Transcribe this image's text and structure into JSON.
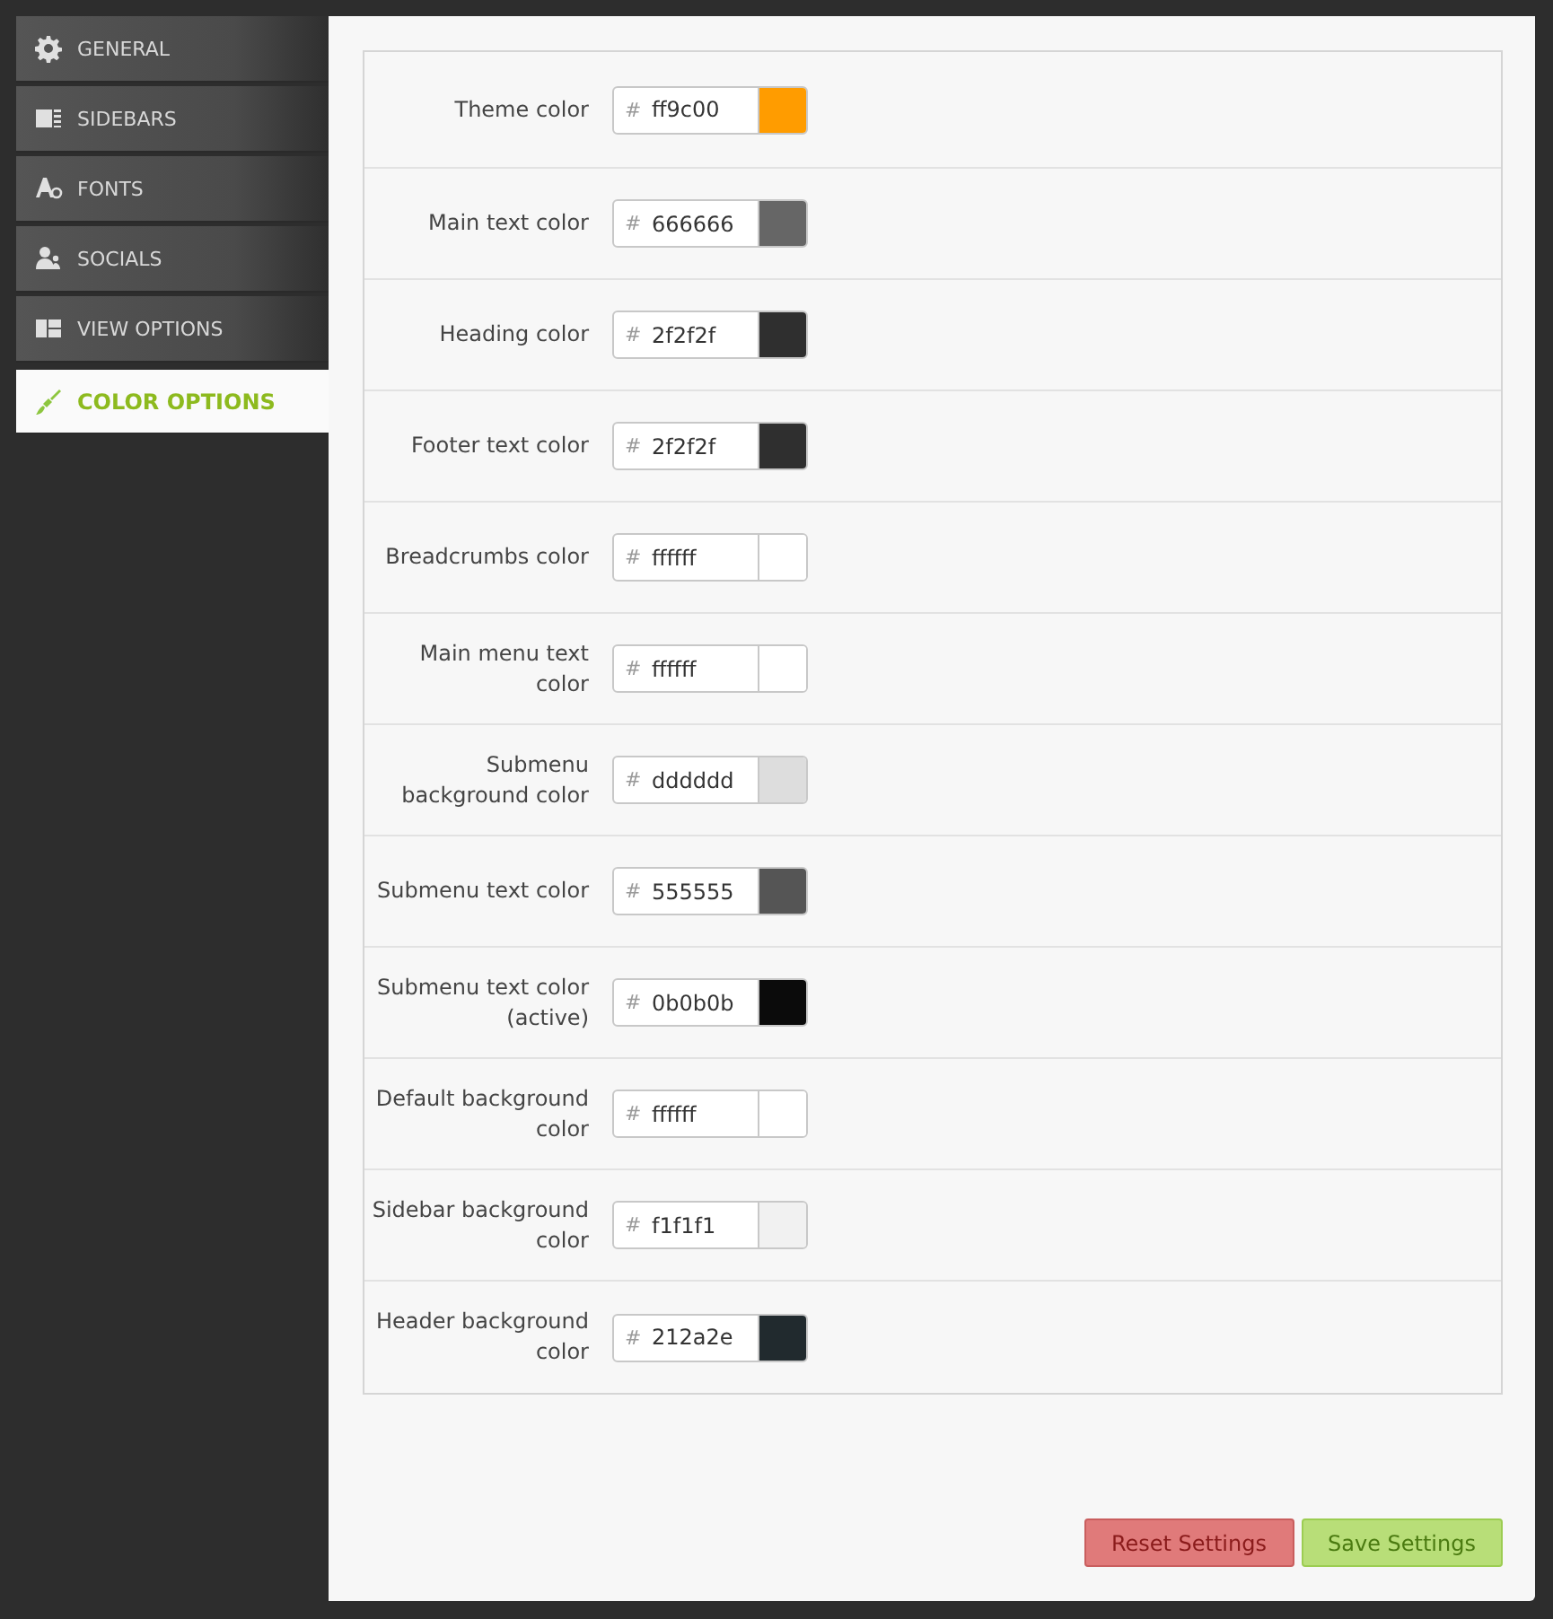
{
  "tabs": [
    {
      "label": "GENERAL",
      "kind": "gear",
      "selected": false
    },
    {
      "label": "SIDEBARS",
      "kind": "sidebar",
      "selected": false
    },
    {
      "label": "FONTS",
      "kind": "font",
      "selected": false
    },
    {
      "label": "SOCIALS",
      "kind": "people",
      "selected": false
    },
    {
      "label": "VIEW OPTIONS",
      "kind": "layout",
      "selected": false
    },
    {
      "label": "COLOR OPTIONS",
      "kind": "brush",
      "selected": true
    }
  ],
  "fields": [
    {
      "label": "Theme color",
      "prefix": "#",
      "value": "ff9c00",
      "color": "#ff9c00"
    },
    {
      "label": "Main text color",
      "prefix": "#",
      "value": "666666",
      "color": "#666666"
    },
    {
      "label": "Heading color",
      "prefix": "#",
      "value": "2f2f2f",
      "color": "#2f2f2f"
    },
    {
      "label": "Footer text color",
      "prefix": "#",
      "value": "2f2f2f",
      "color": "#2f2f2f"
    },
    {
      "label": "Breadcrumbs color",
      "prefix": "#",
      "value": "ffffff",
      "color": "#ffffff"
    },
    {
      "label": "Main menu text color",
      "prefix": "#",
      "value": "ffffff",
      "color": "#ffffff"
    },
    {
      "label": "Submenu background color",
      "prefix": "#",
      "value": "dddddd",
      "color": "#dddddd"
    },
    {
      "label": "Submenu text color",
      "prefix": "#",
      "value": "555555",
      "color": "#555555"
    },
    {
      "label": "Submenu text color (active)",
      "prefix": "#",
      "value": "0b0b0b",
      "color": "#0b0b0b"
    },
    {
      "label": "Default background color",
      "prefix": "#",
      "value": "ffffff",
      "color": "#ffffff"
    },
    {
      "label": "Sidebar background color",
      "prefix": "#",
      "value": "f1f1f1",
      "color": "#f1f1f1"
    },
    {
      "label": "Header background color",
      "prefix": "#",
      "value": "212a2e",
      "color": "#212a2e"
    }
  ],
  "buttons": [
    {
      "label": "Reset Settings",
      "kind": "reset"
    },
    {
      "label": "Save Settings",
      "kind": "save"
    }
  ]
}
